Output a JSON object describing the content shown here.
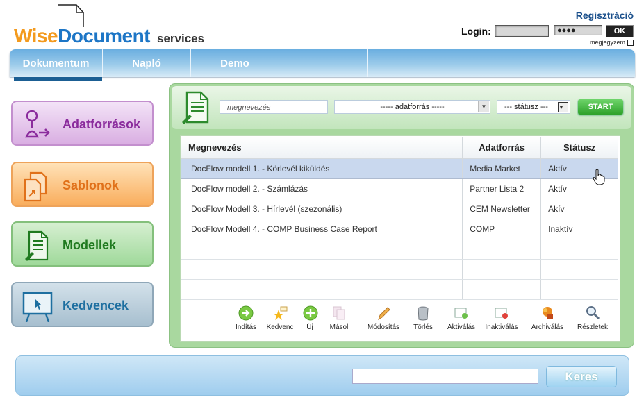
{
  "header": {
    "logo": {
      "wise": "Wise",
      "document": "Document",
      "services": "services"
    },
    "register_link": "Regisztráció",
    "login_label": "Login:",
    "password_mask": "●●●●",
    "ok_label": "OK",
    "remember_label": "megjegyzem"
  },
  "nav": {
    "tabs": [
      {
        "label": "Dokumentum",
        "active": true
      },
      {
        "label": "Napló"
      },
      {
        "label": "Demo"
      }
    ]
  },
  "sidebar": {
    "items": [
      {
        "label": "Adatforrások",
        "icon": "data-source-icon"
      },
      {
        "label": "Sablonok",
        "icon": "templates-icon"
      },
      {
        "label": "Modellek",
        "icon": "models-icon"
      },
      {
        "label": "Kedvencek",
        "icon": "favorites-icon"
      }
    ]
  },
  "filters": {
    "name_placeholder": "megnevezés",
    "source_selected": "----- adatforrás -----",
    "status_selected": "--- státusz ---",
    "start_label": "START"
  },
  "table": {
    "headers": [
      "Megnevezés",
      "Adatforrás",
      "Státusz"
    ],
    "rows": [
      {
        "name": "DocFlow modell 1. - Körlevél kiküldés",
        "source": "Media Market",
        "status": "Aktív",
        "selected": true
      },
      {
        "name": "DocFlow modell 2. - Számlázás",
        "source": "Partner Lista 2",
        "status": "Aktív"
      },
      {
        "name": "DocFlow Modell 3. - Hírlevél (szezonális)",
        "source": "CEM Newsletter",
        "status": "Akív"
      },
      {
        "name": "DocFlow Modell 4. - COMP Business Case Report",
        "source": "COMP",
        "status": "Inaktív"
      }
    ]
  },
  "toolbar": {
    "items": [
      {
        "label": "Indítás",
        "icon": "start-icon"
      },
      {
        "label": "Kedvenc",
        "icon": "favorite-star-icon"
      },
      {
        "label": "Új",
        "icon": "new-plus-icon"
      },
      {
        "label": "Másol",
        "icon": "copy-icon"
      },
      {
        "label": "Módosítás",
        "icon": "edit-pencil-icon"
      },
      {
        "label": "Törlés",
        "icon": "trash-icon"
      },
      {
        "label": "Aktiválás",
        "icon": "activate-icon"
      },
      {
        "label": "Inaktiválás",
        "icon": "deactivate-icon"
      },
      {
        "label": "Archiválás",
        "icon": "archive-icon"
      },
      {
        "label": "Részletek",
        "icon": "details-magnifier-icon"
      }
    ]
  },
  "footer": {
    "search_value": "",
    "search_button": "Keres"
  },
  "colors": {
    "brand_orange": "#f39a1e",
    "brand_blue": "#1d76c6",
    "nav_active": "#1b5e93",
    "selected_row": "#c9d8ee"
  }
}
